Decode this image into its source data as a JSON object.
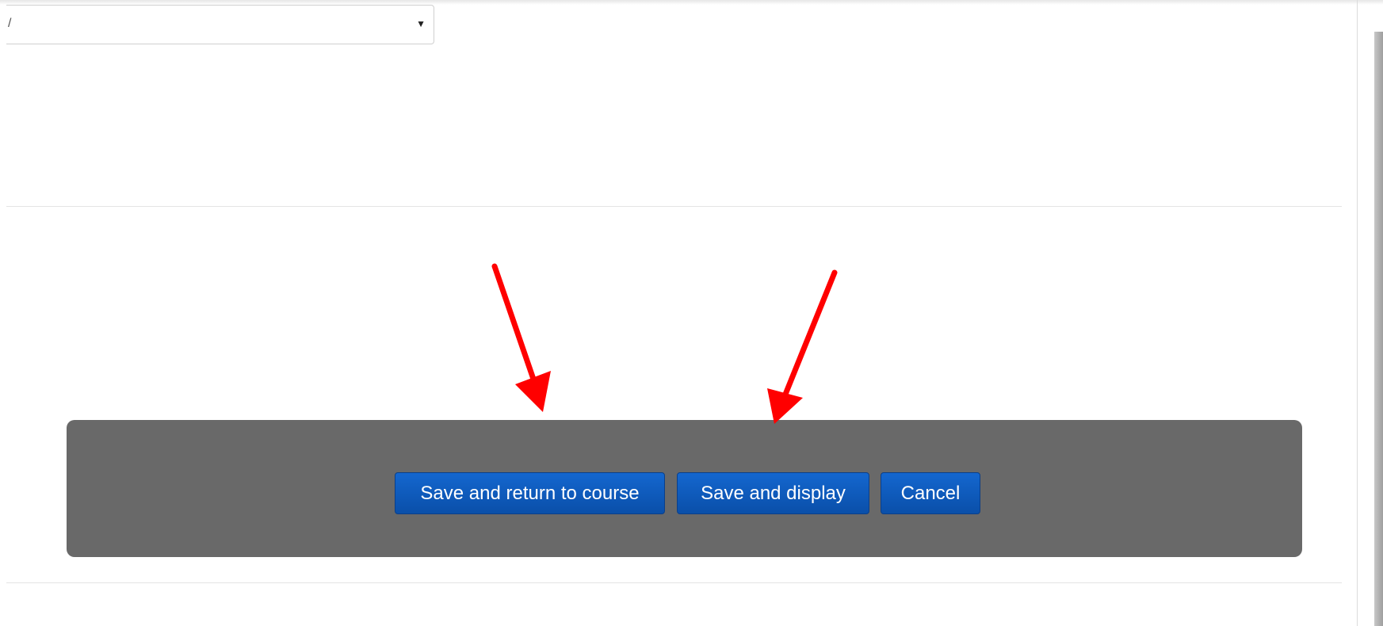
{
  "select": {
    "value": "/"
  },
  "actions": {
    "save_return_label": "Save and return to course",
    "save_display_label": "Save and display",
    "cancel_label": "Cancel"
  },
  "annotations": {
    "arrow_color": "#ff0000",
    "count": 2
  },
  "colors": {
    "button_blue": "#0a5bbd",
    "bar_gray": "#696969"
  }
}
